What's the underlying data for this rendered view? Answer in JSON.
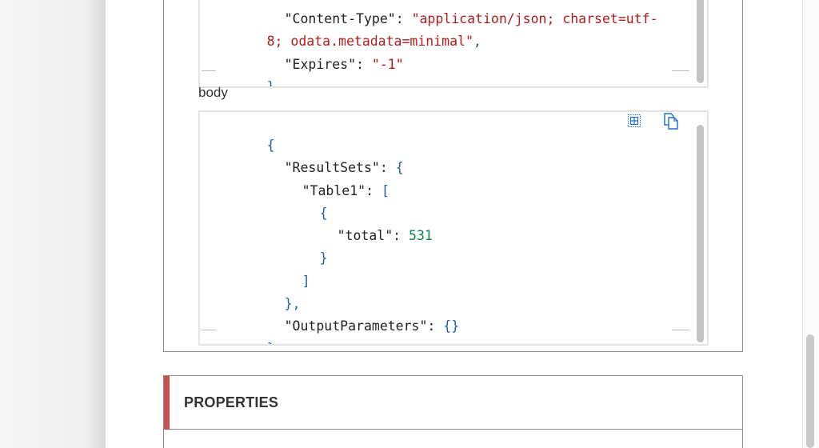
{
  "headers_block": {
    "lines": [
      {
        "k": "\"Content-Type\"",
        "p": ": ",
        "v": "\"application/json; charset=utf-",
        "tail": ""
      },
      {
        "k": "",
        "p": "",
        "v": "8; odata.metadata=minimal\"",
        "tail": ","
      },
      {
        "k": "\"Expires\"",
        "p": ": ",
        "v": "\"-1\"",
        "tail": ""
      },
      {
        "k": "",
        "p": "",
        "v": "",
        "tail": "}"
      }
    ]
  },
  "body_label": "body",
  "body_block": {
    "lines": [
      "{",
      "\"ResultSets\"",
      "\"Table1\"",
      "{",
      "\"total\"",
      "}",
      "]",
      "},",
      "\"OutputParameters\"",
      "}"
    ],
    "total_value": "531",
    "punct": {
      "colon": ": ",
      "open_brace": "{",
      "open_bracket": "[",
      "empty_obj": "{}"
    }
  },
  "toolbar": {
    "expand_icon": "expand-grid-icon",
    "copy_icon": "copy-icon"
  },
  "properties": {
    "title": "PROPERTIES"
  },
  "colors": {
    "accent": "#c9504e",
    "string": "#b01b1b",
    "number": "#0b8a4b",
    "brace": "#1d5fae"
  }
}
